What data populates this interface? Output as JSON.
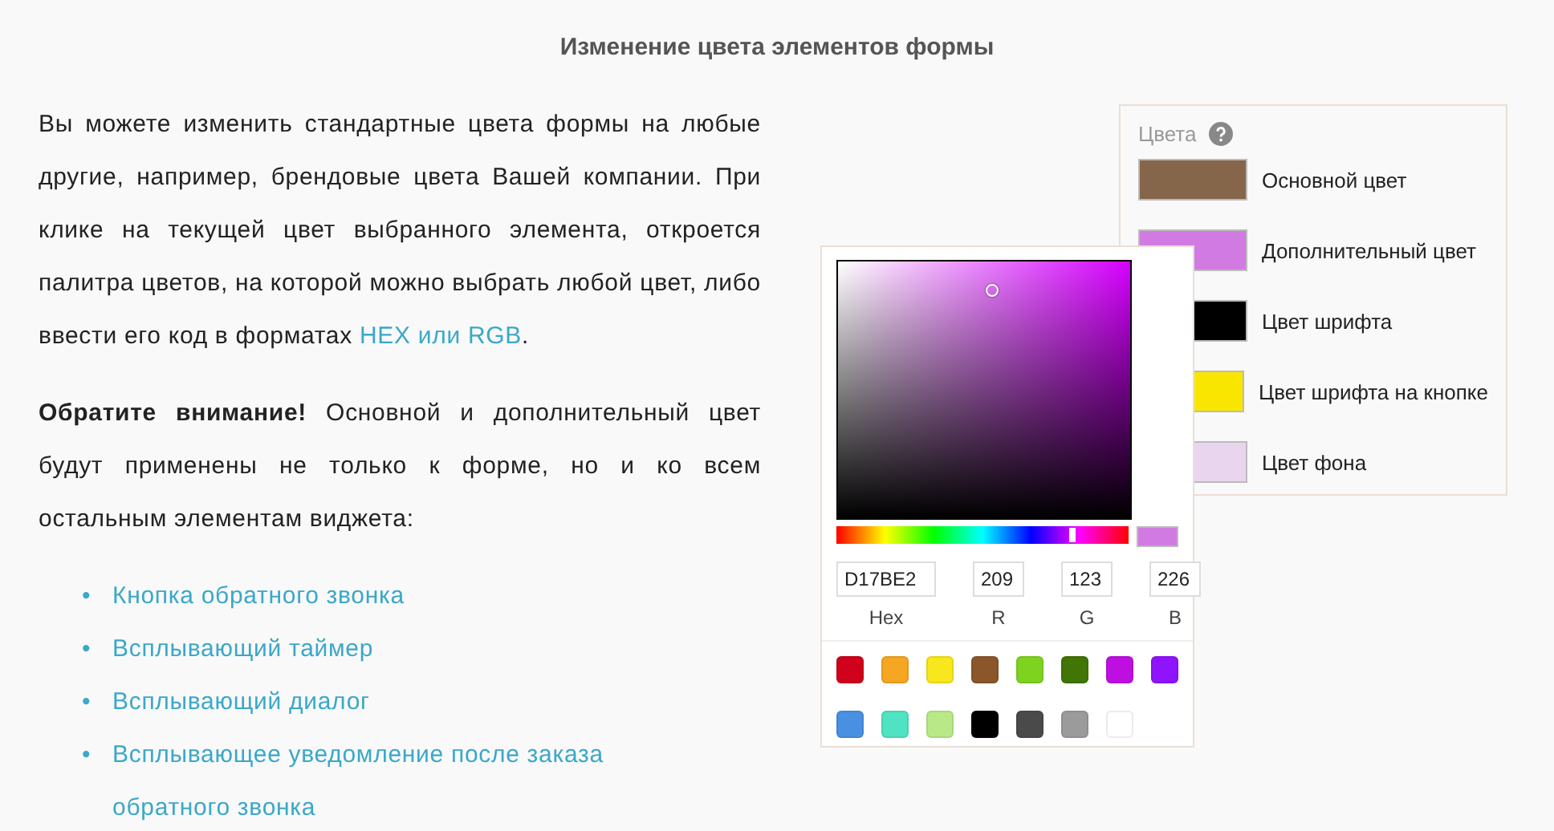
{
  "title": "Изменение цвета элементов формы",
  "intro": {
    "before": "Вы можете изменить стандартные цвета формы на любые другие, например, брендовые цвета Вашей компании. При клике на текущей цвет выбранного элемента, откроется палитра цветов, на которой можно выбрать любой цвет, либо ввести его код в форматах ",
    "link": "HEX или RGB",
    "after": "."
  },
  "note": "**Обратите внимание!** Основной и дополнительный цвет будут применены не только к форме, но и ко всем остальным элементам виджета:",
  "list": [
    {
      "bullet": "•",
      "text": "Кнопка обратного звонка"
    },
    {
      "bullet": "•",
      "text": "Всплывающий таймер"
    },
    {
      "bullet": "•",
      "text": "Всплывающий диалог"
    },
    {
      "bullet": "•",
      "text": "Всплывающее уведомление после заказа обратного звонка"
    }
  ],
  "colors_panel": {
    "title": "Цвета",
    "items": [
      {
        "label": "Основной цвет",
        "color": "#86664a"
      },
      {
        "label": "Дополнительный цвет",
        "color": "#d17be2"
      },
      {
        "label": "Цвет шрифта",
        "color": "#000000"
      },
      {
        "label": "Цвет шрифта на кнопке",
        "color": "#f9e600"
      },
      {
        "label": "Цвет фона",
        "color": "#ead5ef"
      }
    ]
  },
  "picker": {
    "hex": "D17BE2",
    "r": "209",
    "g": "123",
    "b": "226",
    "hex_label": "Hex",
    "r_label": "R",
    "g_label": "G",
    "b_label": "B",
    "swatches": [
      {
        "color": "#d0021b"
      },
      {
        "color": "#f5a623"
      },
      {
        "color": "#f8e71c"
      },
      {
        "color": "#8b572a"
      },
      {
        "color": "#7ed321"
      },
      {
        "color": "#417505"
      },
      {
        "color": "#bd10e0"
      },
      {
        "color": "#9013fe"
      },
      {
        "color": "#4a90e2"
      },
      {
        "color": "#50e3c2"
      },
      {
        "color": "#b8e986"
      },
      {
        "color": "#000000"
      },
      {
        "color": "#4a4a4a"
      },
      {
        "color": "#9b9b9b"
      },
      {
        "color": "#ffffff"
      }
    ]
  }
}
